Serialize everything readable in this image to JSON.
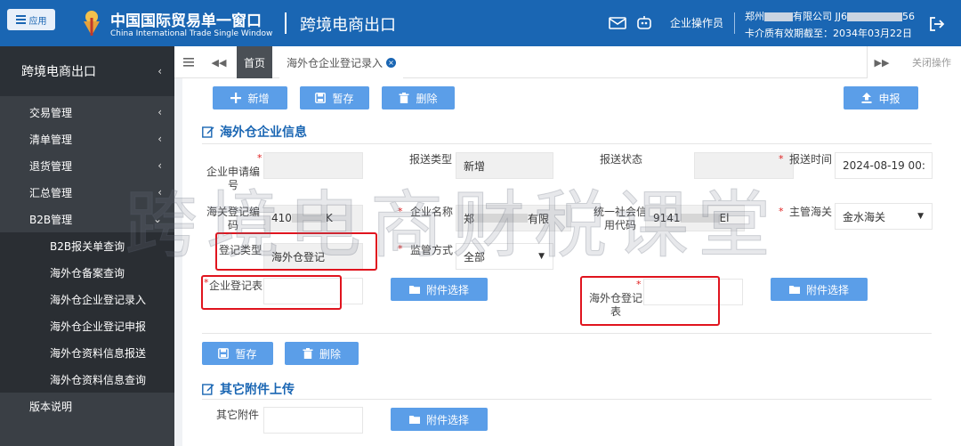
{
  "header": {
    "app_button": "应用",
    "title_cn": "中国国际贸易单一窗口",
    "title_en": "China International Trade Single Window",
    "subsystem": "跨境电商出口",
    "operator": "企业操作员",
    "company_prefix": "郑州",
    "company_middle": "有限公司 JJ6",
    "company_suffix": "56",
    "validity": "卡介质有效期截至：2034年03月22日"
  },
  "sidebar": {
    "title": "跨境电商出口",
    "items": [
      {
        "label": "交易管理"
      },
      {
        "label": "清单管理"
      },
      {
        "label": "退货管理"
      },
      {
        "label": "汇总管理"
      },
      {
        "label": "B2B管理"
      }
    ],
    "subitems": [
      {
        "label": "B2B报关单查询"
      },
      {
        "label": "海外仓备案查询"
      },
      {
        "label": "海外仓企业登记录入"
      },
      {
        "label": "海外仓企业登记申报"
      },
      {
        "label": "海外仓资料信息报送"
      },
      {
        "label": "海外仓资料信息查询"
      }
    ],
    "footer_item": "版本说明"
  },
  "tabs": {
    "home": "首页",
    "active": "海外仓企业登记录入",
    "close_ops": "关闭操作"
  },
  "toolbar": {
    "add": "新增",
    "save": "暂存",
    "delete": "删除",
    "submit": "申报"
  },
  "section1": {
    "title": "海外仓企业信息",
    "labels": {
      "apply_no": "企业申请编号",
      "send_type": "报送类型",
      "send_status": "报送状态",
      "send_time": "报送时间",
      "customs_code": "海关登记编码",
      "company_name": "企业名称",
      "credit_code": "统一社会信用代码",
      "main_customs": "主管海关",
      "reg_type": "登记类型",
      "supervision": "监管方式",
      "company_form": "企业登记表",
      "warehouse_form": "海外仓登记表"
    },
    "values": {
      "send_type": "新增",
      "send_time": "2024-08-19 00:",
      "customs_code_prefix": "410",
      "customs_code_suffix": "K",
      "company_name_prefix": "郑",
      "company_name_suffix": "有限",
      "credit_code_prefix": "9141",
      "credit_code_suffix": "El",
      "main_customs": "金水海关",
      "reg_type": "海外仓登记",
      "supervision": "全部"
    },
    "attach_label": "附件选择"
  },
  "form_actions": {
    "save": "暂存",
    "delete": "删除"
  },
  "section2": {
    "title": "其它附件上传",
    "label": "其它附件",
    "attach_label": "附件选择"
  },
  "watermark": "跨境电商财税课堂",
  "colors": {
    "header_bg": "#1a66b3",
    "button_bg": "#5b9ee8",
    "sidebar_bg": "#3a3f45",
    "highlight_red": "#e0141e"
  }
}
